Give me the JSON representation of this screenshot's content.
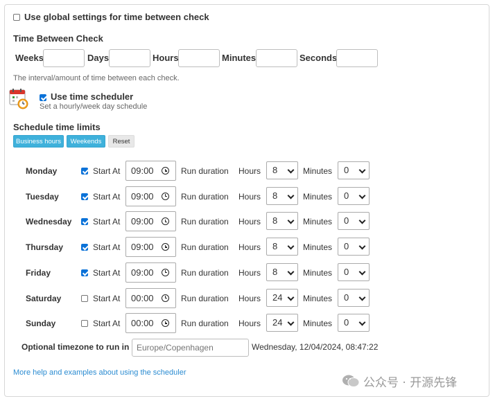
{
  "global_settings": {
    "label": "Use global settings for time between check",
    "checked": false
  },
  "time_between": {
    "title": "Time Between Check",
    "fields": [
      {
        "label": "Weeks",
        "value": ""
      },
      {
        "label": "Days",
        "value": ""
      },
      {
        "label": "Hours",
        "value": ""
      },
      {
        "label": "Minutes",
        "value": ""
      },
      {
        "label": "Seconds",
        "value": ""
      }
    ],
    "help": "The interval/amount of time between each check."
  },
  "scheduler": {
    "label": "Use time scheduler",
    "checked": true,
    "subtitle": "Set a hourly/week day schedule",
    "icon": "calendar-clock-icon"
  },
  "limits": {
    "title": "Schedule time limits",
    "buttons": {
      "business": "Business hours",
      "weekends": "Weekends",
      "reset": "Reset"
    }
  },
  "labels": {
    "start_at": "Start At",
    "run_duration": "Run duration",
    "hours": "Hours",
    "minutes": "Minutes"
  },
  "days": [
    {
      "name": "Monday",
      "enabled": true,
      "start": "09:00",
      "hours": "8",
      "minutes": "0"
    },
    {
      "name": "Tuesday",
      "enabled": true,
      "start": "09:00",
      "hours": "8",
      "minutes": "0"
    },
    {
      "name": "Wednesday",
      "enabled": true,
      "start": "09:00",
      "hours": "8",
      "minutes": "0"
    },
    {
      "name": "Thursday",
      "enabled": true,
      "start": "09:00",
      "hours": "8",
      "minutes": "0"
    },
    {
      "name": "Friday",
      "enabled": true,
      "start": "09:00",
      "hours": "8",
      "minutes": "0"
    },
    {
      "name": "Saturday",
      "enabled": false,
      "start": "00:00",
      "hours": "24",
      "minutes": "0"
    },
    {
      "name": "Sunday",
      "enabled": false,
      "start": "00:00",
      "hours": "24",
      "minutes": "0"
    }
  ],
  "timezone": {
    "label": "Optional timezone to run in",
    "placeholder": "Europe/Copenhagen",
    "current_time": "Wednesday, 12/04/2024, 08:47:22"
  },
  "help_link": "More help and examples about using the scheduler",
  "watermark": "公众号 · 开源先锋",
  "colors": {
    "accent": "#3fb1db",
    "check": "#0b72d8",
    "link": "#2a8bd1"
  }
}
